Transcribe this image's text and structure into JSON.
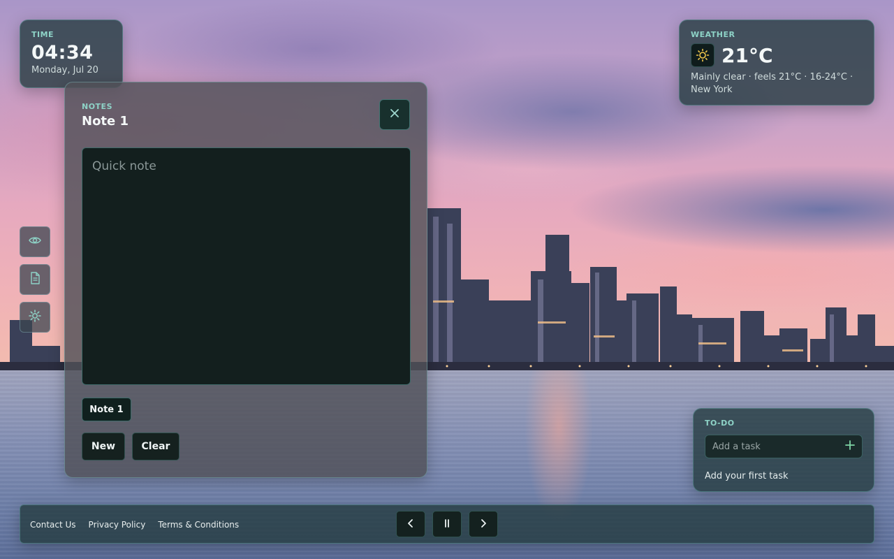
{
  "time_widget": {
    "label": "TIME",
    "time": "04:34",
    "date": "Monday, Jul 20"
  },
  "weather_widget": {
    "label": "WEATHER",
    "icon": "sun-icon",
    "temperature": "21°C",
    "description": "Mainly clear · feels 21°C · 16-24°C ·",
    "location": "New York"
  },
  "side_rail": {
    "items": [
      {
        "icon": "eye-icon"
      },
      {
        "icon": "document-icon"
      },
      {
        "icon": "gear-icon"
      }
    ]
  },
  "notes_panel": {
    "label": "NOTES",
    "title": "Note 1",
    "close_icon": "close-icon",
    "textarea_placeholder": "Quick note",
    "textarea_value": "",
    "tabs": [
      {
        "label": "Note 1"
      }
    ],
    "new_label": "New",
    "clear_label": "Clear"
  },
  "todo_widget": {
    "label": "TO-DO",
    "input_placeholder": "Add a task",
    "add_icon": "plus-icon",
    "empty_text": "Add your first task"
  },
  "footer": {
    "links": [
      {
        "label": "Contact Us"
      },
      {
        "label": "Privacy Policy"
      },
      {
        "label": "Terms & Conditions"
      }
    ],
    "player": {
      "prev_icon": "chevron-left-icon",
      "pause_icon": "pause-icon",
      "next_icon": "chevron-right-icon"
    }
  },
  "colors": {
    "accent": "#8ed3c7",
    "panel": "#233a3e",
    "button": "#15211f",
    "plus": "#7fd6a6",
    "sun": "#f2c94c"
  }
}
